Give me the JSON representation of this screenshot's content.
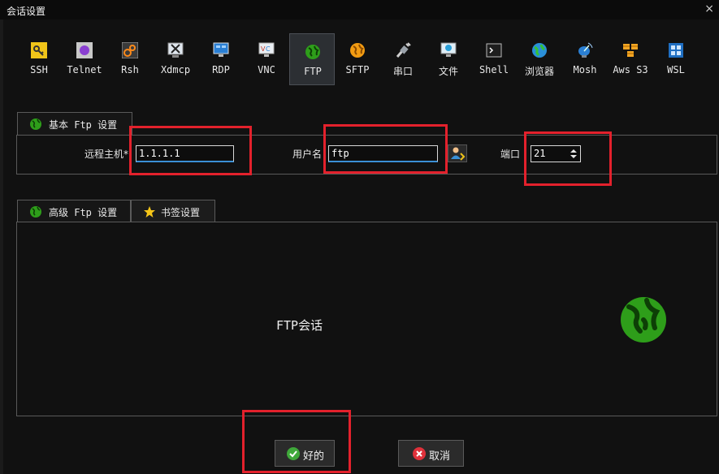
{
  "window": {
    "title": "会话设置",
    "close_label": "×"
  },
  "session_types": [
    {
      "label": "SSH",
      "icon": "key-icon"
    },
    {
      "label": "Telnet",
      "icon": "telnet-icon"
    },
    {
      "label": "Rsh",
      "icon": "rsh-icon"
    },
    {
      "label": "Xdmcp",
      "icon": "xdmcp-icon"
    },
    {
      "label": "RDP",
      "icon": "rdp-monitor-icon"
    },
    {
      "label": "VNC",
      "icon": "vnc-monitor-icon"
    },
    {
      "label": "FTP",
      "icon": "ftp-globe-icon",
      "active": true
    },
    {
      "label": "SFTP",
      "icon": "sftp-globe-icon"
    },
    {
      "label": "串口",
      "icon": "serial-plug-icon"
    },
    {
      "label": "文件",
      "icon": "file-monitor-icon"
    },
    {
      "label": "Shell",
      "icon": "shell-terminal-icon"
    },
    {
      "label": "浏览器",
      "icon": "browser-globe-icon"
    },
    {
      "label": "Mosh",
      "icon": "satellite-dish-icon"
    },
    {
      "label": "Aws S3",
      "icon": "aws-cubes-icon"
    },
    {
      "label": "WSL",
      "icon": "windows-logo-icon"
    }
  ],
  "basic": {
    "tab_label": "基本 Ftp 设置",
    "remote_host_label": "远程主机*",
    "remote_host_value": "1.1.1.1",
    "username_label": "用户名",
    "username_value": "ftp",
    "port_label": "端口",
    "port_value": "21"
  },
  "advanced": {
    "tabs": [
      {
        "label": "高级 Ftp 设置",
        "icon": "globe-icon"
      },
      {
        "label": "书签设置",
        "icon": "star-icon"
      }
    ],
    "center_text": "FTP会话"
  },
  "buttons": {
    "ok_label": "好的",
    "cancel_label": "取消"
  },
  "colors": {
    "highlight": "#e3212c",
    "accent": "#3a8fd6",
    "globe": "#2e9e1a"
  }
}
